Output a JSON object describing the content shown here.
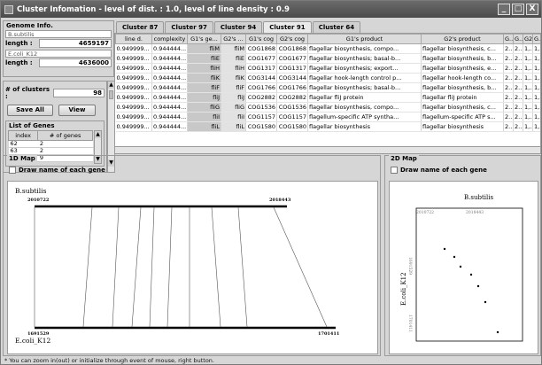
{
  "window": {
    "title": "Cluster Infomation - level of dist. : 1.0, level of line density : 0.9",
    "minimize": "_",
    "maximize": "□",
    "close": "X"
  },
  "genome_info": {
    "title": "Genome Info.",
    "genome1_name": "B.subtilis",
    "genome1_length_label": "length :",
    "genome1_length": "4659197",
    "genome2_name": "E.coli_K12",
    "genome2_length_label": "length :",
    "genome2_length": "4636000"
  },
  "clusters": {
    "label": "# of clusters :",
    "value": "98",
    "save_all": "Save All",
    "view": "View"
  },
  "genes_list": {
    "title": "List of Genes",
    "columns": [
      "index",
      "# of genes"
    ],
    "rows": [
      [
        "62",
        "2"
      ],
      [
        "63",
        "2"
      ],
      [
        "64",
        "9"
      ]
    ]
  },
  "tabs": [
    "Cluster 87",
    "Cluster 97",
    "Cluster 94",
    "Cluster 91",
    "Cluster 64"
  ],
  "active_tab": 3,
  "table": {
    "columns": [
      "line d.",
      "complexity",
      "G1's ge...",
      "G2's ...",
      "G1's cog",
      "G2's cog",
      "G1's product",
      "G2's product",
      "G...",
      "G...",
      "G2...",
      "G..."
    ],
    "rows": [
      [
        "0.949999...",
        "0.944444...",
        "fliM",
        "fliM",
        "COG1868",
        "COG1868",
        "flagellar biosynthesis, compo...",
        "flagellar biosynthesis, c...",
        "2...",
        "2...",
        "1,...",
        "1,..."
      ],
      [
        "0.949999...",
        "0.944444...",
        "fliE",
        "fliE",
        "COG1677",
        "COG1677",
        "flagellar biosynthesis; basal-b...",
        "flagellar biosynthesis, b...",
        "2...",
        "2...",
        "1,...",
        "1,..."
      ],
      [
        "0.949999...",
        "0.944444...",
        "fliH",
        "fliH",
        "COG1317",
        "COG1317",
        "flagellar biosynthesis; export...",
        "flagellar biosynthesis, e...",
        "2...",
        "2...",
        "1,...",
        "1,..."
      ],
      [
        "0.949999...",
        "0.944444...",
        "fliK",
        "fliK",
        "COG3144",
        "COG3144",
        "flagellar hook-length control p...",
        "flagellar hook-length co...",
        "2...",
        "2...",
        "1,...",
        "1,..."
      ],
      [
        "0.949999...",
        "0.944444...",
        "fliF",
        "fliF",
        "COG1766",
        "COG1766",
        "flagellar biosynthesis; basal-b...",
        "flagellar biosynthesis, b...",
        "2...",
        "2...",
        "1,...",
        "1,..."
      ],
      [
        "0.949999...",
        "0.944444...",
        "fliJ",
        "fliJ",
        "COG2882",
        "COG2882",
        "flagellar fliJ protein",
        "flagellar fliJ protein",
        "2...",
        "2...",
        "1,...",
        "1,..."
      ],
      [
        "0.949999...",
        "0.944444...",
        "fliG",
        "fliG",
        "COG1536",
        "COG1536",
        "flagellar biosynthesis, compo...",
        "flagellar biosynthesis, c...",
        "2...",
        "2...",
        "1,...",
        "1,..."
      ],
      [
        "0.949999...",
        "0.944444...",
        "fliI",
        "fliI",
        "COG1157",
        "COG1157",
        "flagellum-specific ATP syntha...",
        "flagellum-specific ATP s...",
        "2...",
        "2...",
        "1,...",
        "1,..."
      ],
      [
        "0.949999...",
        "0.944444...",
        "fliL",
        "fliL",
        "COG1580",
        "COG1580",
        "flagellar biosynthesis",
        "flagellar biosynthesis",
        "2...",
        "2...",
        "1,...",
        "1,..."
      ]
    ]
  },
  "map1d": {
    "title": "1D Map",
    "checkbox_label": "Draw name of each gene",
    "top_genome": "B.subtilis",
    "bottom_genome": "E.coli_K12",
    "top_start": "2010722",
    "top_end": "2018443",
    "bottom_start": "1691529",
    "bottom_end": "1701411"
  },
  "map2d": {
    "title": "2D Map",
    "checkbox_label": "Draw name of each gene",
    "x_genome": "B.subtilis",
    "y_genome": "E.coli_K12",
    "x_start": "2010722",
    "x_end": "2018443",
    "y_start": "1691529",
    "y_end": "1701411"
  },
  "status": "* You can zoom in(out) or initialize through event of mouse, right button."
}
